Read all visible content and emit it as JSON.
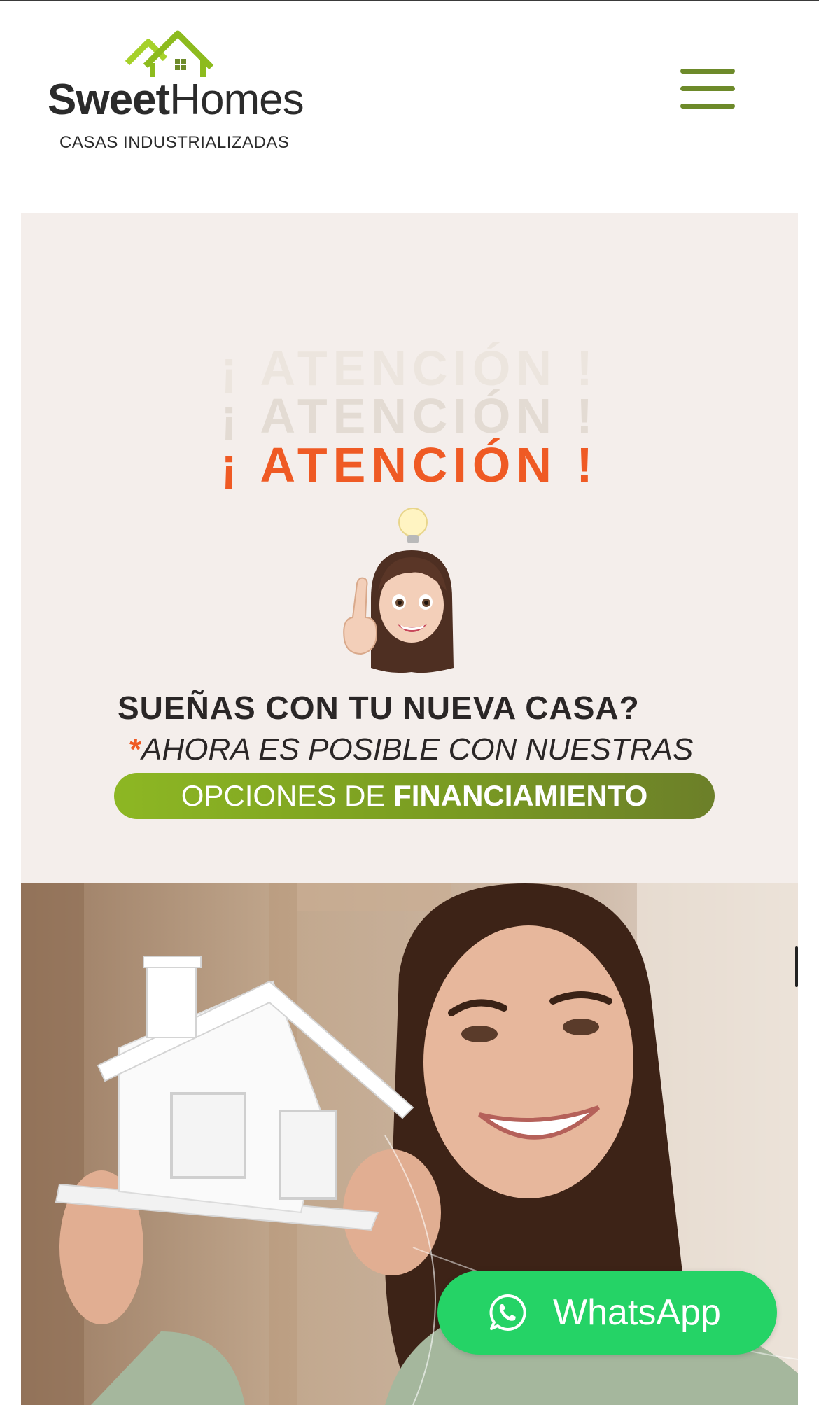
{
  "header": {
    "brand_bold": "Sweet",
    "brand_light": "Homes",
    "tagline": "CASAS INDUSTRIALIZADAS",
    "menu_icon": "hamburger-menu-icon"
  },
  "promo": {
    "attention_faded_1": "¡ ATENCIÓN !",
    "attention_faded_2": "¡ ATENCIÓN !",
    "attention": "¡ ATENCIÓN !",
    "question": "SUEÑAS CON TU NUEVA CASA?",
    "asterisk": "*",
    "subline": "AHORA ES POSIBLE CON NUESTRAS",
    "pill_light": "OPCIONES DE ",
    "pill_bold": "FINANCIAMIENTO",
    "accent_color": "#ef5a24",
    "brand_green": "#7a9c22"
  },
  "whatsapp": {
    "label": "WhatsApp",
    "icon": "whatsapp-icon",
    "color": "#25d366"
  }
}
